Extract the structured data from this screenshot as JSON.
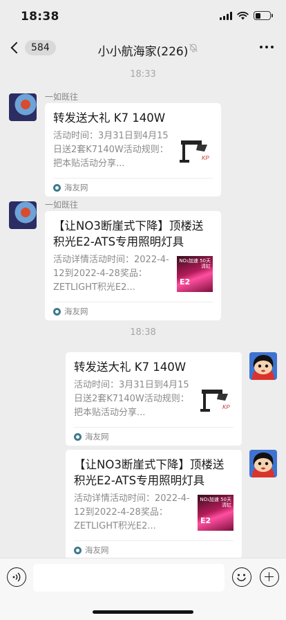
{
  "status_bar": {
    "time": "18:38",
    "battery_level": 0.35
  },
  "nav": {
    "unread_count": "584",
    "title": "小小航海家(226)"
  },
  "timestamps": [
    "18:33",
    "18:38"
  ],
  "messages": [
    {
      "side": "left",
      "sender": "一如既往",
      "title": "转发送大礼 K7 140W",
      "description": "活动时间：3月31日到4月15日送2套K7140W活动规则：把本贴活动分享...",
      "source": "海友网",
      "thumb": "lamp"
    },
    {
      "side": "left",
      "sender": "一如既往",
      "title": "【让NO3断崖式下降】顶楼送积光E2-ATS专用照明灯具",
      "description": "活动详情活动时间：2022-4-12到2022-4-28奖品：ZETLIGHT积光E2...",
      "source": "海友网",
      "thumb": "pink"
    },
    {
      "side": "right",
      "title": "转发送大礼 K7 140W",
      "description": "活动时间：3月31日到4月15日送2套K7140W活动规则：把本贴活动分享...",
      "source": "海友网",
      "thumb": "lamp"
    },
    {
      "side": "right",
      "title": "【让NO3断崖式下降】顶楼送积光E2-ATS专用照明灯具",
      "description": "活动详情活动时间：2022-4-12到2022-4-28奖品：ZETLIGHT积光E2...",
      "source": "海友网",
      "thumb": "pink"
    }
  ],
  "thumb_pink_text": {
    "top": "NO₃加速 50天清缸",
    "model": "E2"
  },
  "icons": {
    "signal": "signal-icon",
    "wifi": "wifi-icon",
    "battery": "battery-icon",
    "mute": "mute-bell-icon",
    "more": "more-dots-icon",
    "voice": "voice-icon",
    "emoji": "emoji-icon",
    "plus": "plus-icon",
    "source": "haiyou-logo-icon"
  },
  "colors": {
    "background": "#ededed",
    "card": "#ffffff",
    "input_bar": "#f7f7f7"
  }
}
